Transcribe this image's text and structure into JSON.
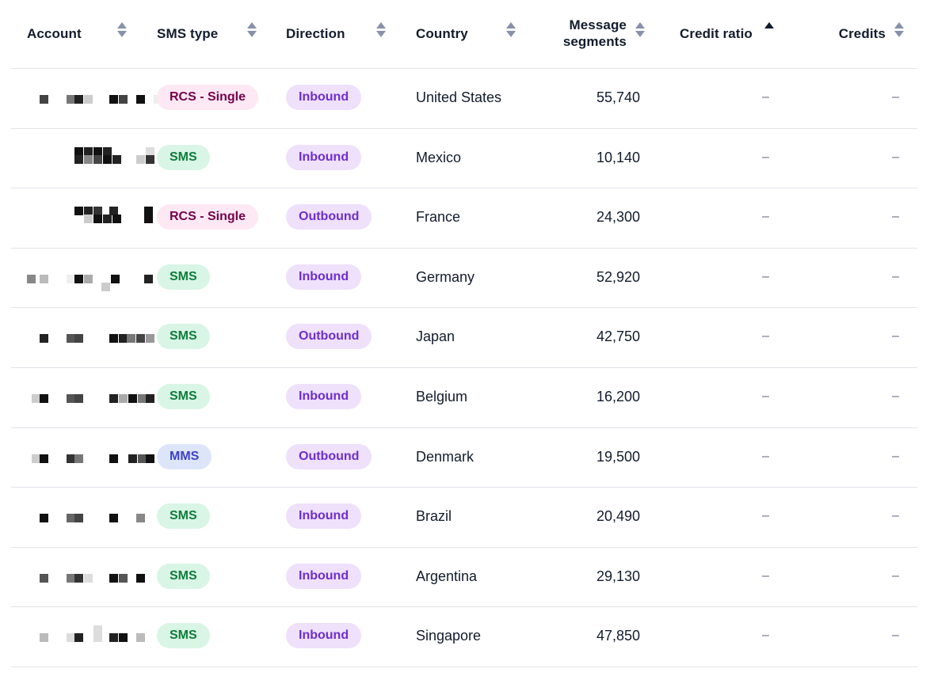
{
  "columns": {
    "account": "Account",
    "sms_type": "SMS type",
    "direction": "Direction",
    "country": "Country",
    "segments_line1": "Message",
    "segments_line2": "segments",
    "credit_ratio": "Credit ratio",
    "credits": "Credits"
  },
  "rows": [
    {
      "type": "RCS - Single",
      "type_kind": "rcs",
      "direction": "Inbound",
      "country": "United States",
      "segments": "55,740",
      "credit_ratio": "–",
      "credits": "–"
    },
    {
      "type": "SMS",
      "type_kind": "sms",
      "direction": "Inbound",
      "country": "Mexico",
      "segments": "10,140",
      "credit_ratio": "–",
      "credits": "–"
    },
    {
      "type": "RCS - Single",
      "type_kind": "rcs",
      "direction": "Outbound",
      "country": "France",
      "segments": "24,300",
      "credit_ratio": "–",
      "credits": "–"
    },
    {
      "type": "SMS",
      "type_kind": "sms",
      "direction": "Inbound",
      "country": "Germany",
      "segments": "52,920",
      "credit_ratio": "–",
      "credits": "–"
    },
    {
      "type": "SMS",
      "type_kind": "sms",
      "direction": "Outbound",
      "country": "Japan",
      "segments": "42,750",
      "credit_ratio": "–",
      "credits": "–"
    },
    {
      "type": "SMS",
      "type_kind": "sms",
      "direction": "Inbound",
      "country": "Belgium",
      "segments": "16,200",
      "credit_ratio": "–",
      "credits": "–"
    },
    {
      "type": "MMS",
      "type_kind": "mms",
      "direction": "Outbound",
      "country": "Denmark",
      "segments": "19,500",
      "credit_ratio": "–",
      "credits": "–"
    },
    {
      "type": "SMS",
      "type_kind": "sms",
      "direction": "Inbound",
      "country": "Brazil",
      "segments": "20,490",
      "credit_ratio": "–",
      "credits": "–"
    },
    {
      "type": "SMS",
      "type_kind": "sms",
      "direction": "Inbound",
      "country": "Argentina",
      "segments": "29,130",
      "credit_ratio": "–",
      "credits": "–"
    },
    {
      "type": "SMS",
      "type_kind": "sms",
      "direction": "Inbound",
      "country": "Singapore",
      "segments": "47,850",
      "credit_ratio": "–",
      "credits": "–"
    }
  ],
  "sort": {
    "active_column": "credit_ratio",
    "direction": "ascending"
  },
  "icons": {
    "sort": "sort-arrows-icon",
    "sort_active": "sort-ascending-icon"
  }
}
